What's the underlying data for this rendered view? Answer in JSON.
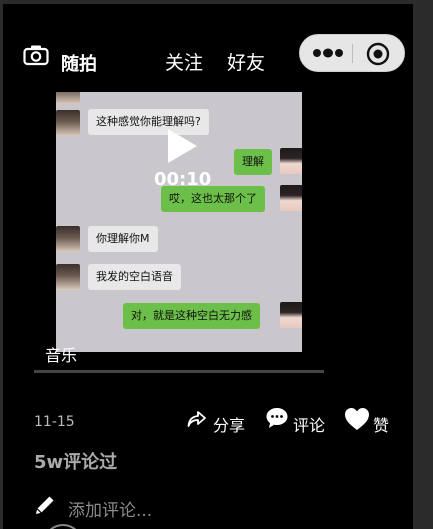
{
  "header": {
    "snap_label": "随拍",
    "tabs": [
      {
        "label": "关注"
      },
      {
        "label": "好友"
      }
    ]
  },
  "video": {
    "duration": "00:10",
    "messages": [
      {
        "side": "left",
        "text": "这种感觉你能理解吗?"
      },
      {
        "side": "right",
        "text": "理解"
      },
      {
        "side": "right",
        "text": "哎，这也太那个了"
      },
      {
        "side": "left",
        "text": "你理解你M"
      },
      {
        "side": "left",
        "text": "我发的空白语音"
      },
      {
        "side": "right",
        "text": "对，就是这种空白无力感"
      }
    ],
    "music_label": "音乐"
  },
  "actions": {
    "date": "11-15",
    "share_label": "分享",
    "comment_label": "评论",
    "like_label": "赞"
  },
  "comments": {
    "count_label": "5w评论过",
    "input_placeholder": "添加评论..."
  },
  "colors": {
    "green_bubble": "#6cbf48",
    "white_bubble": "#e8e8e8",
    "capsule": "#e6e6e6"
  }
}
